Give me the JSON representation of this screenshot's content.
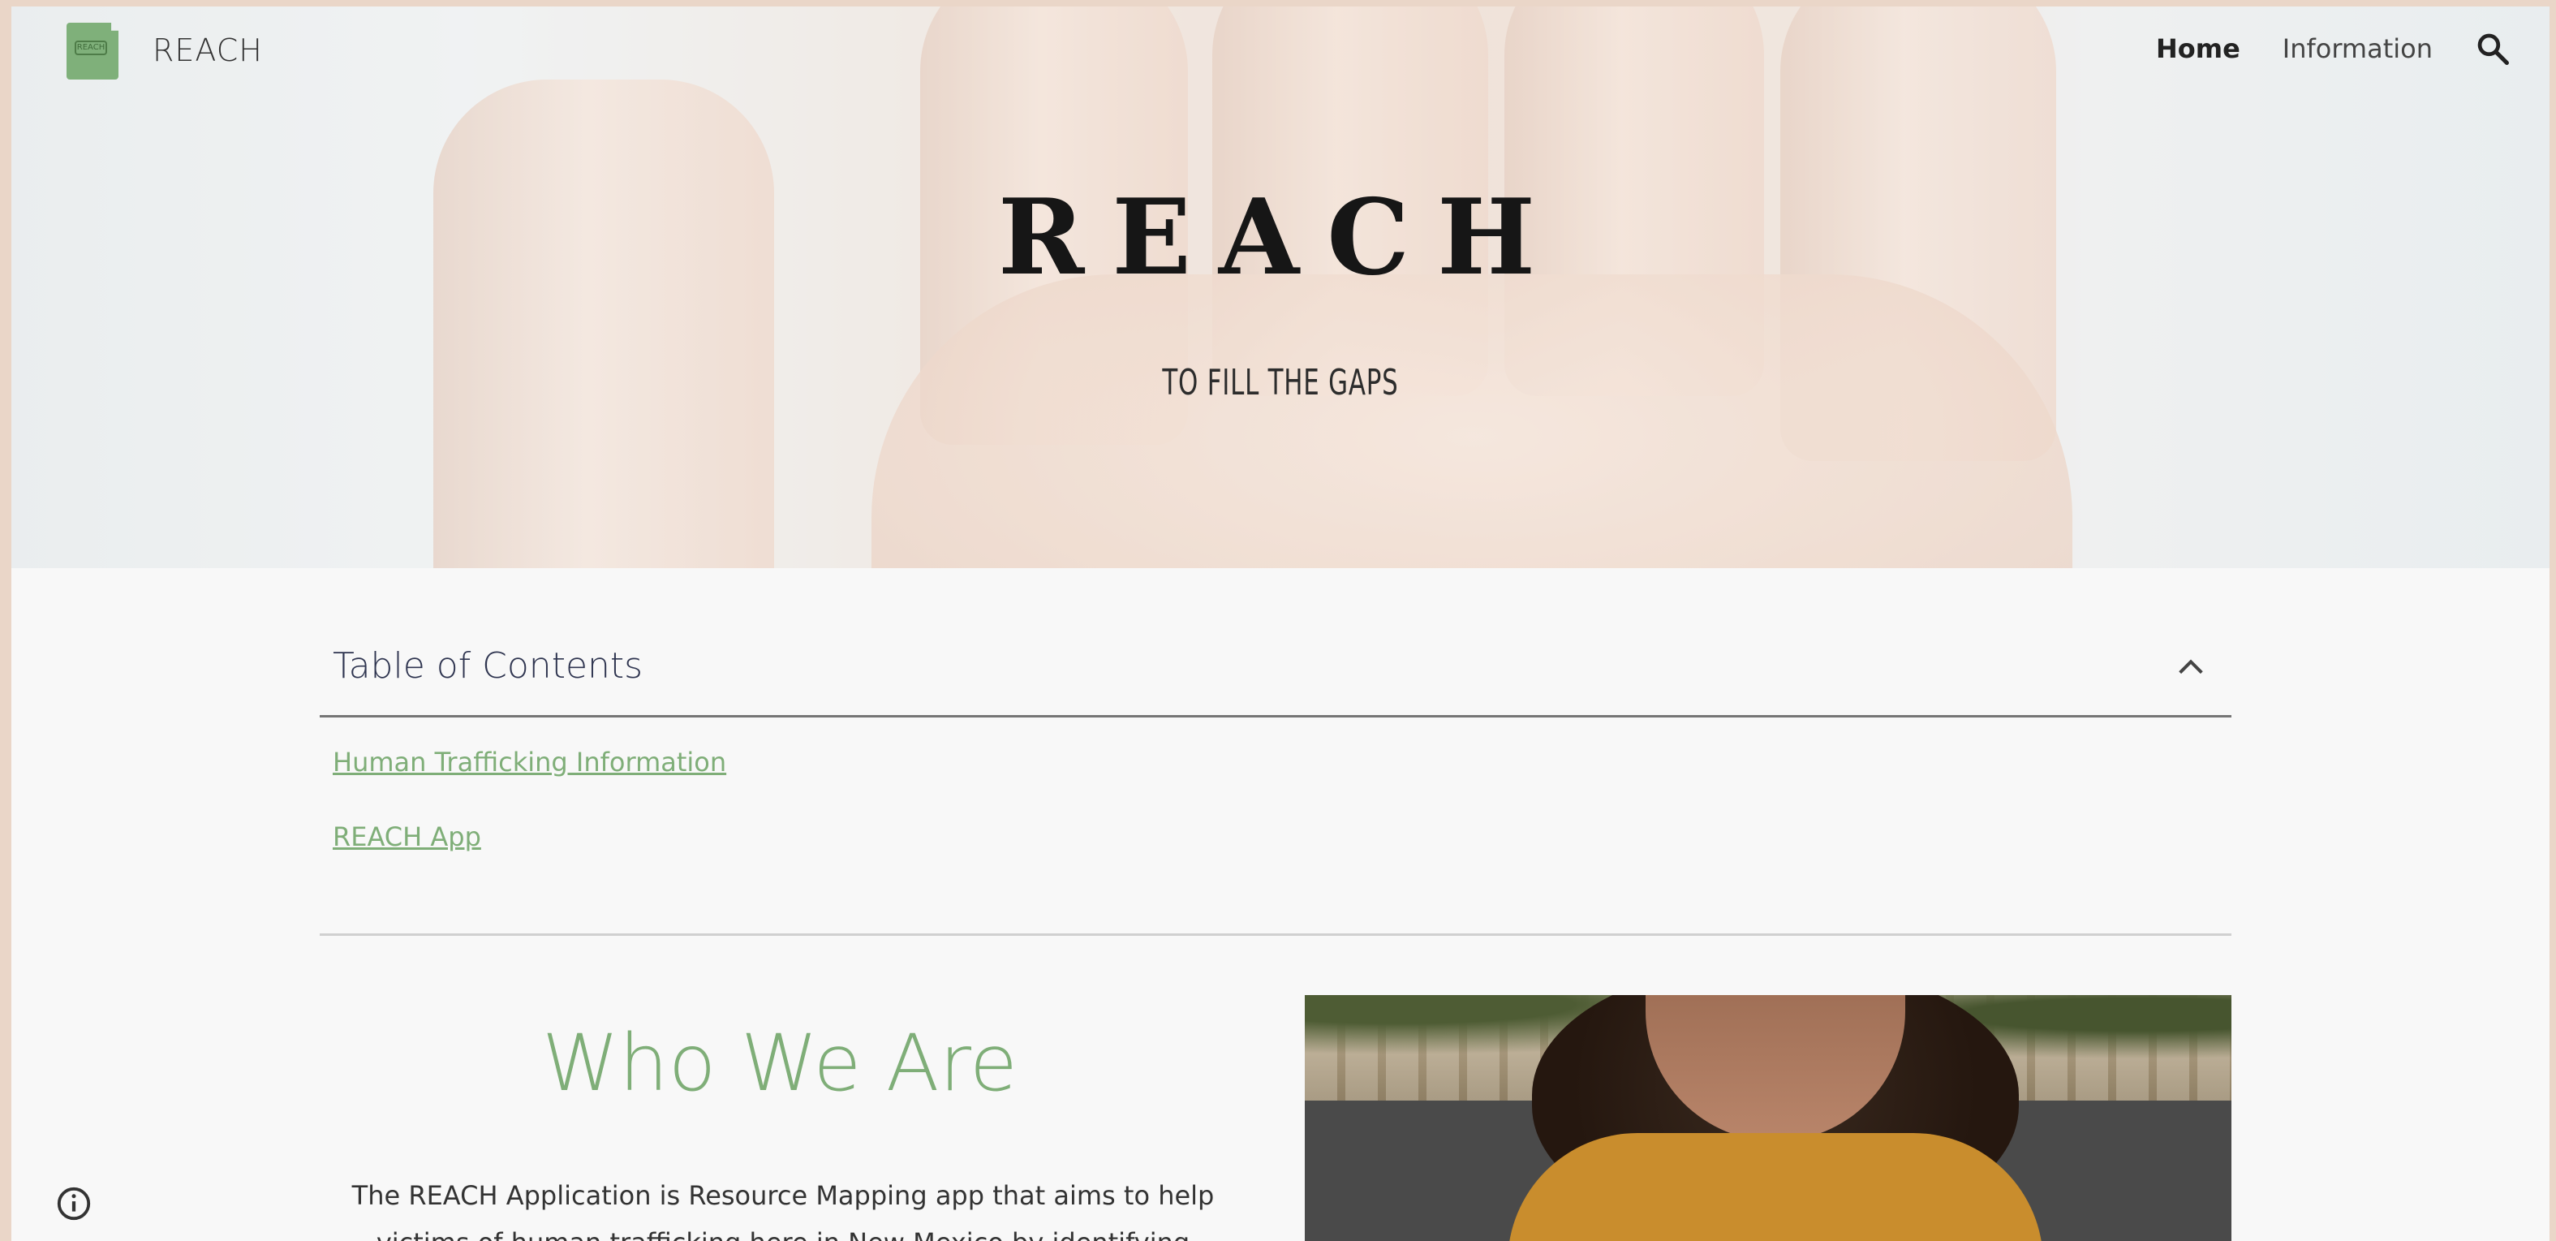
{
  "site": {
    "name": "REACH",
    "logo_text": "REACH"
  },
  "nav": {
    "items": [
      {
        "label": "Home",
        "active": true
      },
      {
        "label": "Information",
        "active": false
      }
    ],
    "search_icon": "search-icon"
  },
  "hero": {
    "title": "REACH",
    "subtitle": "TO FILL THE GAPS"
  },
  "toc": {
    "title": "Table of Contents",
    "expanded": true,
    "links": [
      "Human Trafficking Information",
      "REACH App"
    ]
  },
  "section": {
    "title": "Who We Are",
    "text": "The REACH Application is Resource Mapping app that aims to help victims of human trafficking here in New Mexico by identifying"
  },
  "colors": {
    "accent": "#7fae78",
    "background": "#f8f8f8",
    "frame": "#ead6c8"
  }
}
